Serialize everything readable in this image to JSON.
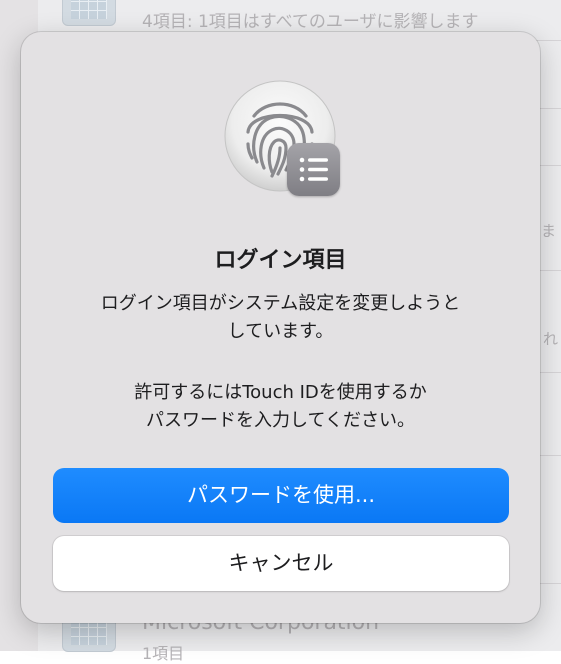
{
  "background": {
    "top_text": "4項目: 1項目はすべてのユーザに影響します",
    "edge_text_1": "ま",
    "edge_text_2": "れ",
    "bottom_text": "Microsoft Corporation",
    "bottom_sub": "1項目"
  },
  "dialog": {
    "title": "ログイン項目",
    "message_line1": "ログイン項目がシステム設定を変更しようと",
    "message_line2": "しています。",
    "prompt_line1": "許可するにはTouch IDを使用するか",
    "prompt_line2": "パスワードを入力してください。",
    "primary_button": "パスワードを使用...",
    "cancel_button": "キャンセル",
    "icon": "fingerprint-icon",
    "badge_icon": "list-icon"
  },
  "colors": {
    "accent": "#0a78f5",
    "dialog_bg": "#e3e1e3",
    "text": "#1d1d1f"
  }
}
